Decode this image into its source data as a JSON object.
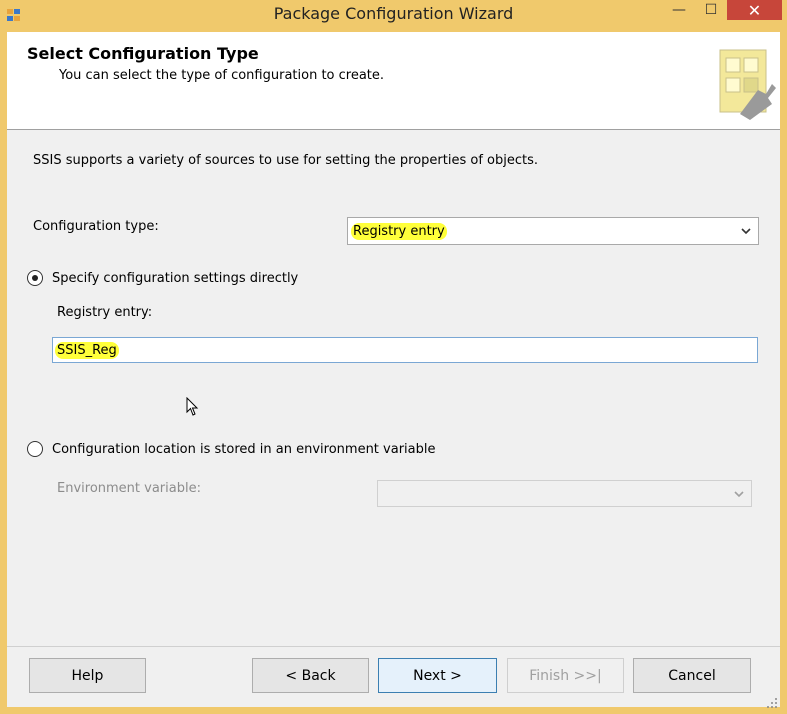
{
  "window": {
    "title": "Package Configuration Wizard",
    "min_glyph": "—",
    "max_glyph": "☐",
    "close_glyph": "✕"
  },
  "header": {
    "title": "Select Configuration Type",
    "subtitle": "You can select the type of configuration to create."
  },
  "content": {
    "intro": "SSIS supports a variety of sources to use for setting the properties of objects.",
    "configuration_type_label": "Configuration type:",
    "configuration_type_value": "Registry entry",
    "radio_direct_label": "Specify configuration settings directly",
    "radio_direct_checked": true,
    "registry_entry_label": "Registry entry:",
    "registry_entry_value": "SSIS_Reg",
    "radio_env_label": "Configuration location is stored in an environment variable",
    "radio_env_checked": false,
    "environment_variable_label": "Environment variable:",
    "environment_variable_value": ""
  },
  "buttons": {
    "help": "Help",
    "back": "< Back",
    "next": "Next >",
    "finish": "Finish >>|",
    "cancel": "Cancel"
  },
  "colors": {
    "titlebar": "#f0c96c",
    "close_button": "#c7463a",
    "highlight": "#ffff3a"
  }
}
